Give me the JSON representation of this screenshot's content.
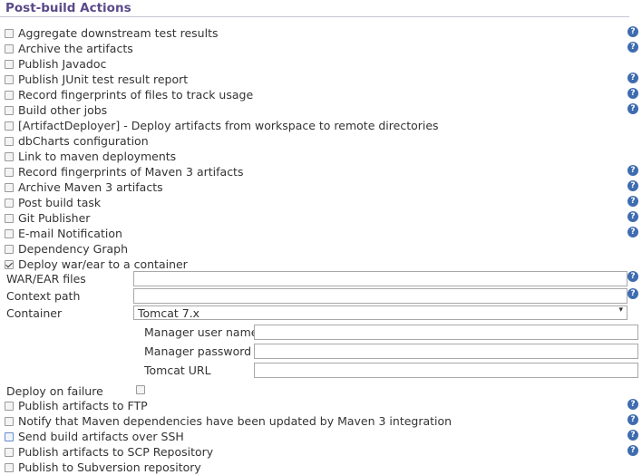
{
  "section": {
    "title": "Post-build Actions"
  },
  "actions_top": [
    {
      "label": "Aggregate downstream test results",
      "checked": false,
      "help": true
    },
    {
      "label": "Archive the artifacts",
      "checked": false,
      "help": true
    },
    {
      "label": "Publish Javadoc",
      "checked": false,
      "help": false
    },
    {
      "label": "Publish JUnit test result report",
      "checked": false,
      "help": true
    },
    {
      "label": "Record fingerprints of files to track usage",
      "checked": false,
      "help": true
    },
    {
      "label": "Build other jobs",
      "checked": false,
      "help": true
    },
    {
      "label": "[ArtifactDeployer] - Deploy artifacts from workspace to remote directories",
      "checked": false,
      "help": false
    },
    {
      "label": "dbCharts configuration",
      "checked": false,
      "help": false
    },
    {
      "label": "Link to maven deployments",
      "checked": false,
      "help": false
    },
    {
      "label": "Record fingerprints of Maven 3 artifacts",
      "checked": false,
      "help": true
    },
    {
      "label": "Archive Maven 3 artifacts",
      "checked": false,
      "help": true
    },
    {
      "label": "Post build task",
      "checked": false,
      "help": true
    },
    {
      "label": "Git Publisher",
      "checked": false,
      "help": true
    },
    {
      "label": "E-mail Notification",
      "checked": false,
      "help": true
    },
    {
      "label": "Dependency Graph",
      "checked": false,
      "help": false
    },
    {
      "label": "Deploy war/ear to a container",
      "checked": true,
      "help": false
    }
  ],
  "deploy": {
    "war_label": "WAR/EAR files",
    "war_value": "",
    "context_label": "Context path",
    "context_value": "",
    "container_label": "Container",
    "container_value": "Tomcat 7.x",
    "manager_user_label": "Manager user name",
    "manager_user_value": "",
    "manager_password_label": "Manager password",
    "manager_password_value": "",
    "tomcat_url_label": "Tomcat URL",
    "tomcat_url_value": "",
    "deploy_on_failure_label": "Deploy on failure",
    "deploy_on_failure_checked": false
  },
  "actions_bottom": [
    {
      "label": "Publish artifacts to FTP",
      "checked": false,
      "help": true
    },
    {
      "label": "Notify that Maven dependencies have been updated by Maven 3 integration",
      "checked": false,
      "help": true
    },
    {
      "label": "Send build artifacts over SSH",
      "checked": false,
      "help": true,
      "highlight": true
    },
    {
      "label": "Publish artifacts to SCP Repository",
      "checked": false,
      "help": true
    },
    {
      "label": "Publish to Subversion repository",
      "checked": false,
      "help": false
    }
  ],
  "help_glyph": "?",
  "icons": {
    "help": "help-icon",
    "dropdown": "chevron-down-icon"
  },
  "colors": {
    "title": "#5a4a8a",
    "help": "#3f6cb0",
    "rule": "#c9c2d6"
  }
}
